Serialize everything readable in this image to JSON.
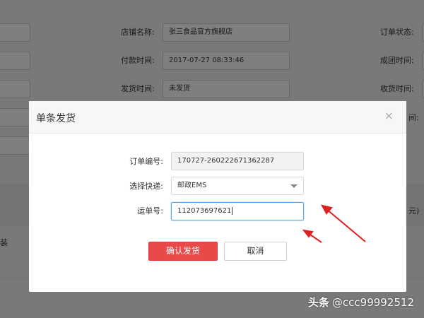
{
  "background": {
    "rows": [
      {
        "label": "店铺名称:",
        "value": "张三食品官方旗舰店",
        "right_label": "订单状态:"
      },
      {
        "label": "付款时间:",
        "value": "2017-07-27 08:33:46",
        "right_label": "成团时间:"
      },
      {
        "label": "发货时间:",
        "value": "未发货",
        "right_label": "收货时间:"
      },
      {
        "right_label": "间:"
      }
    ],
    "left_text": "装",
    "right_partial": "元)"
  },
  "modal": {
    "title": "单条发货",
    "close": "×",
    "fields": [
      {
        "label": "订单编号:",
        "value": "170727-260222671362287"
      },
      {
        "label": "选择快递:",
        "value": "邮政EMS"
      },
      {
        "label": "运单号:",
        "value": "112073697621"
      }
    ],
    "confirm_label": "确认发货",
    "cancel_label": "取消"
  },
  "annotation": {
    "arrow_color": "#e02020"
  },
  "watermark": {
    "icon": "头条",
    "text": "@ccc99992512"
  },
  "colors": {
    "primary": "#e84a4a",
    "focus": "#58a6e8"
  }
}
